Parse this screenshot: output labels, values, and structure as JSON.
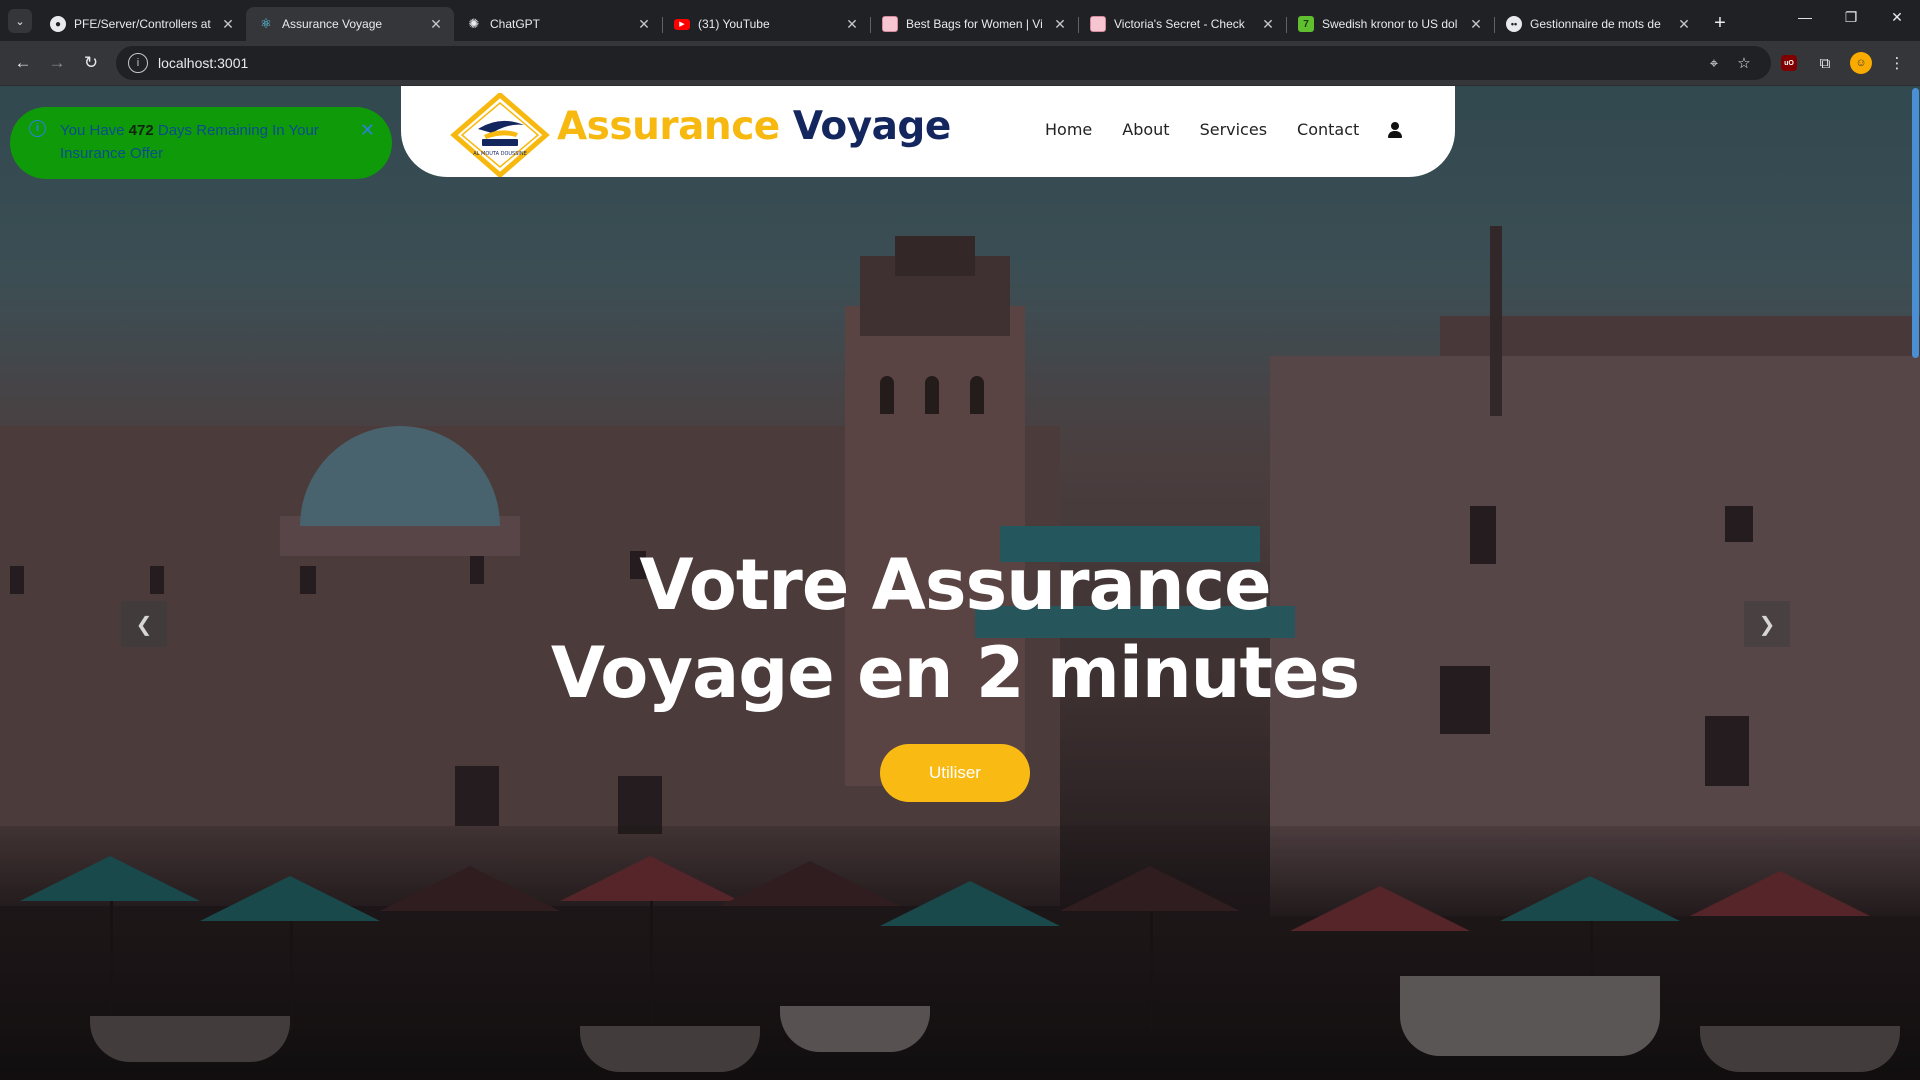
{
  "browser": {
    "tabs": [
      {
        "title": "PFE/Server/Controllers at",
        "favicon": "github-icon",
        "active": false
      },
      {
        "title": "Assurance Voyage",
        "favicon": "react-icon",
        "active": true
      },
      {
        "title": "ChatGPT",
        "favicon": "chatgpt-icon",
        "active": false
      },
      {
        "title": "(31) YouTube",
        "favicon": "youtube-icon",
        "active": false
      },
      {
        "title": "Best Bags for Women | Vi",
        "favicon": "victorias-secret-icon",
        "active": false
      },
      {
        "title": "Victoria's Secret - Check",
        "favicon": "victorias-secret-icon",
        "active": false
      },
      {
        "title": "Swedish kronor to US dol",
        "favicon": "currency-icon",
        "active": false
      },
      {
        "title": "Gestionnaire de mots de",
        "favicon": "password-manager-icon",
        "active": false
      }
    ],
    "url": "localhost:3001"
  },
  "site": {
    "brand_part1": "Assurance",
    "brand_part2": "Voyage",
    "nav": [
      "Home",
      "About",
      "Services",
      "Contact"
    ],
    "logo_caption": "AL MOUTA DOUSSINE"
  },
  "toast": {
    "text_before": "You Have ",
    "days": "472",
    "text_after": " Days Remaining In Your Insurance Offer"
  },
  "hero": {
    "title_line1": "Votre Assurance",
    "title_line2": "Voyage en 2 minutes",
    "cta_label": "Utiliser"
  },
  "colors": {
    "brand_yellow": "#f7b90f",
    "brand_navy": "#14265e",
    "toast_green": "#0f9a0a",
    "cta_yellow": "#f9bb13"
  }
}
